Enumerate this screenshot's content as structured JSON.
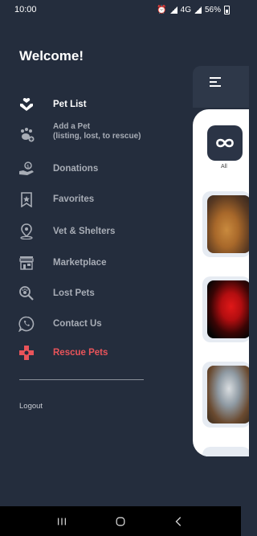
{
  "status_bar": {
    "time": "10:00",
    "network": "4G",
    "battery": "56%"
  },
  "drawer": {
    "welcome": "Welcome!",
    "items": [
      {
        "label": "Pet List",
        "icon": "hand-heart-icon",
        "state": "active"
      },
      {
        "label_line1": "Add a Pet",
        "label_line2": "(listing, lost, to rescue)",
        "icon": "paw-add-icon",
        "state": "normal"
      },
      {
        "label": "Donations",
        "icon": "hand-coin-icon",
        "state": "normal"
      },
      {
        "label": "Favorites",
        "icon": "bookmark-star-icon",
        "state": "normal"
      },
      {
        "label": "Vet & Shelters",
        "icon": "location-pin-icon",
        "state": "normal"
      },
      {
        "label": "Marketplace",
        "icon": "store-icon",
        "state": "normal"
      },
      {
        "label": "Lost Pets",
        "icon": "search-paw-icon",
        "state": "normal"
      },
      {
        "label": "Contact Us",
        "icon": "whatsapp-icon",
        "state": "normal"
      },
      {
        "label": "Rescue Pets",
        "icon": "rescue-cross-icon",
        "state": "highlight"
      }
    ],
    "logout": "Logout"
  },
  "preview": {
    "category_label": "All"
  },
  "colors": {
    "background": "#242d3d",
    "rescue_accent": "#e9545a",
    "inactive_text": "#a8adb6"
  }
}
